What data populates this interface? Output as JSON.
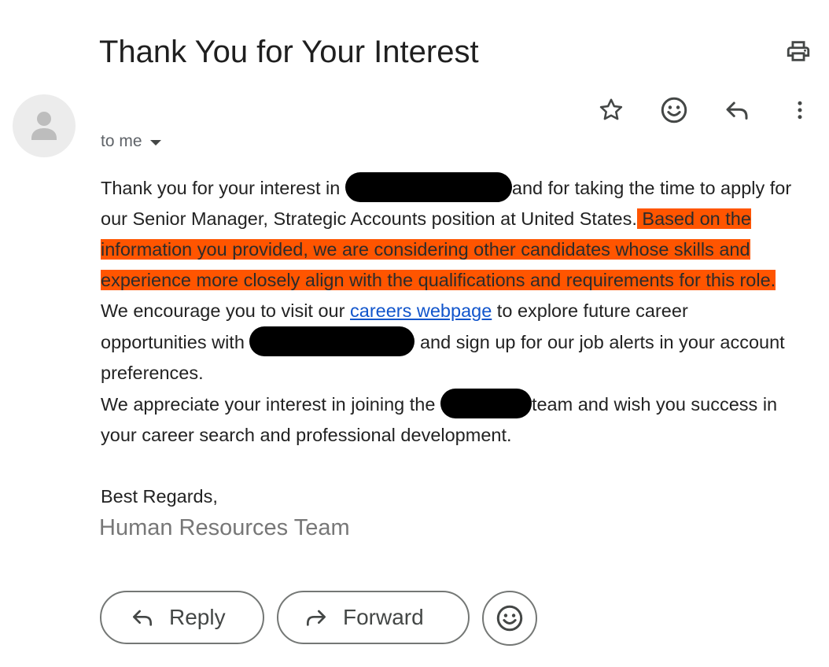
{
  "email": {
    "subject": "Thank You for Your Interest",
    "recipient_label": "to me",
    "body": {
      "p1_part1": "Thank you for your interest in ",
      "p1_part2": "and for taking the time to apply for our Senior Manager, Strategic Accounts position at United States.",
      "p1_highlight": " Based on the information you provided, we are considering other candidates whose skills and experience more closely align with the qualifications and requirements for this role.",
      "p2_part1": "We encourage you to visit our ",
      "p2_link": "careers webpage",
      "p2_part2": " to explore future career opportunities with ",
      "p2_part3": " and sign up for our job alerts in your account preferences.",
      "p3_part1": "We appreciate your interest in joining the ",
      "p3_part2": "team and wish you success in your career search and professional development.",
      "closing": "Best Regards,",
      "signature": "Human Resources Team"
    }
  },
  "toolbar": {
    "icons": [
      "print-icon",
      "star-icon",
      "emoji-icon",
      "reply-icon",
      "more-vert-icon"
    ]
  },
  "buttons": {
    "reply_label": "Reply",
    "forward_label": "Forward"
  },
  "colors": {
    "highlight": "#ff5500",
    "link": "#1155cc",
    "redaction": "#000000"
  }
}
